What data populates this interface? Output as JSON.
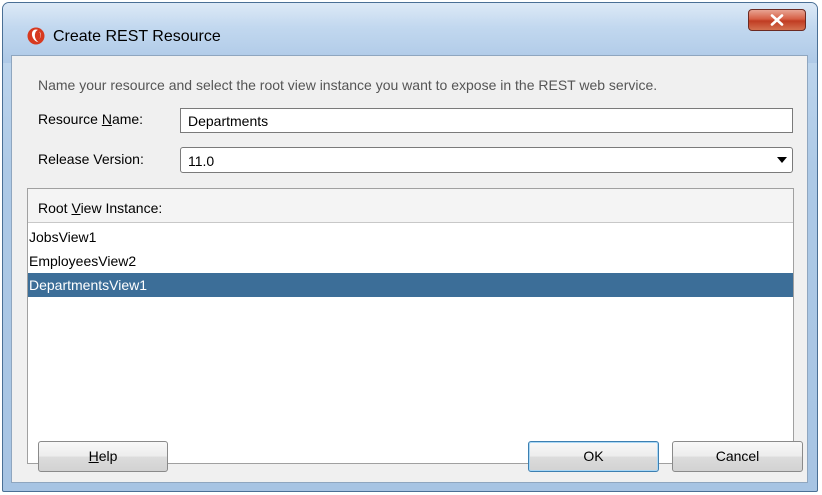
{
  "window": {
    "title": "Create REST Resource",
    "close_glyph": "X"
  },
  "dialog": {
    "prompt": "Name your resource and select the root view instance you want to expose in the REST web service."
  },
  "resource_name": {
    "label_pre": "Resource ",
    "label_mnemonic": "N",
    "label_post": "ame:",
    "value": "Departments"
  },
  "release_version": {
    "label": "Release Version:",
    "selected": "11.0"
  },
  "root_view": {
    "header_pre": "Root ",
    "header_mnemonic": "V",
    "header_post": "iew Instance:",
    "items": [
      "JobsView1",
      "EmployeesView2",
      "DepartmentsView1"
    ],
    "selected_index": 2
  },
  "buttons": {
    "help_mnemonic": "H",
    "help_rest": "elp",
    "ok": "OK",
    "cancel": "Cancel"
  },
  "colors": {
    "selection": "#3c6e98",
    "title_bar": "#c2d8ef",
    "close_button": "#c8452b"
  },
  "icons": {
    "app": "oracle-jdeveloper-logo-icon",
    "close": "close-x-icon",
    "dropdown": "caret-down-icon",
    "resize": "resize-grip-icon"
  }
}
